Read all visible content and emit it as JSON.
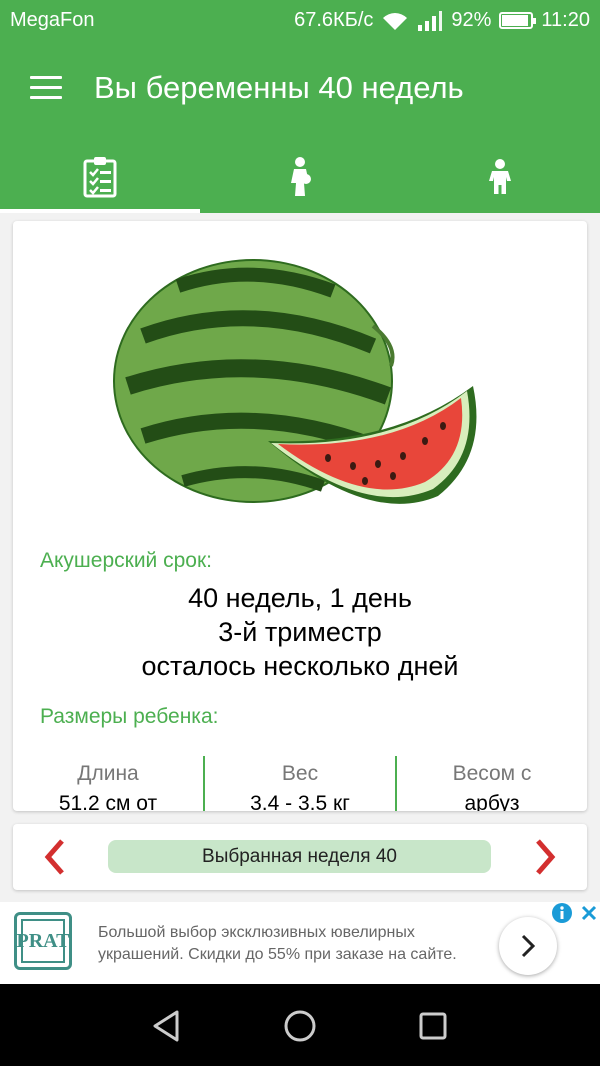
{
  "status_bar": {
    "carrier": "MegaFon",
    "speed": "67.6КБ/с",
    "battery": "92%",
    "battery_level": 0.92,
    "time": "11:20"
  },
  "app_bar": {
    "title": "Вы беременны 40 недель"
  },
  "tabs": [
    {
      "icon": "clipboard-checklist-icon",
      "active": true
    },
    {
      "icon": "pregnant-woman-icon",
      "active": false
    },
    {
      "icon": "child-icon",
      "active": false
    }
  ],
  "card": {
    "image": "watermelon-illustration",
    "obstetric_label": "Акушерский срок:",
    "term_lines": [
      "40 недель, 1 день",
      "3-й триместр",
      "осталось несколько дней"
    ],
    "sizes_label": "Размеры ребенка:",
    "sizes": [
      {
        "head": "Длина",
        "value": "51.2 см от"
      },
      {
        "head": "Вес",
        "value": "3.4 - 3.5 кг"
      },
      {
        "head": "Весом с",
        "value": "арбуз"
      }
    ]
  },
  "week_selector": {
    "label": "Выбранная неделя 40",
    "prev_icon": "chevron-left-icon",
    "next_icon": "chevron-right-icon"
  },
  "ad": {
    "logo_text": "PRAT",
    "text": "Большой выбор эксклюзивных ювелирных украшений. Скидки до 55% при заказе на сайте.",
    "info_icon": "info-icon",
    "close_icon": "close-icon",
    "go_icon": "chevron-right-icon"
  },
  "colors": {
    "accent": "#4caf50",
    "label_green": "#4caf50",
    "arrow_red": "#d32f2f",
    "pill": "#c8e6c9"
  }
}
